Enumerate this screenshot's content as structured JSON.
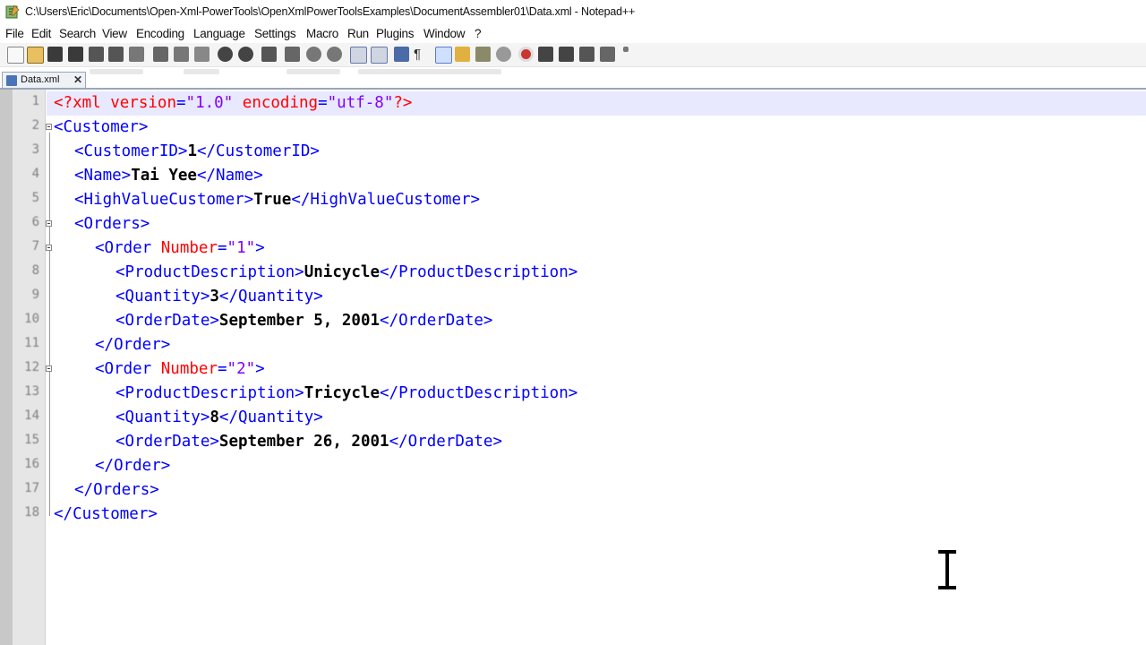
{
  "window": {
    "title": "C:\\Users\\Eric\\Documents\\Open-Xml-PowerTools\\OpenXmlPowerToolsExamples\\DocumentAssembler01\\Data.xml - Notepad++"
  },
  "menu": [
    "File",
    "Edit",
    "Search",
    "View",
    "Encoding",
    "Language",
    "Settings",
    "Macro",
    "Run",
    "Plugins",
    "Window",
    "?"
  ],
  "tab": {
    "label": "Data.xml",
    "close": "✕"
  },
  "line_numbers": [
    "1",
    "2",
    "3",
    "4",
    "5",
    "6",
    "7",
    "8",
    "9",
    "10",
    "11",
    "12",
    "13",
    "14",
    "15",
    "16",
    "17",
    "18"
  ],
  "code": {
    "l1": {
      "open": "<?xml",
      "attr1": "version",
      "eq1": "=",
      "val1": "\"1.0\"",
      "attr2": "encoding",
      "eq2": "=",
      "val2": "\"utf-8\"",
      "close": "?>"
    },
    "l2": {
      "tag": "<Customer>"
    },
    "l3": {
      "open": "<CustomerID>",
      "text": "1",
      "close": "</CustomerID>"
    },
    "l4": {
      "open": "<Name>",
      "text": "Tai Yee",
      "close": "</Name>"
    },
    "l5": {
      "open": "<HighValueCustomer>",
      "text": "True",
      "close": "</HighValueCustomer>"
    },
    "l6": {
      "tag": "<Orders>"
    },
    "l7": {
      "open": "<Order",
      "attr": "Number",
      "eq": "=",
      "val": "\"1\"",
      "close": ">"
    },
    "l8": {
      "open": "<ProductDescription>",
      "text": "Unicycle",
      "close": "</ProductDescription>"
    },
    "l9": {
      "open": "<Quantity>",
      "text": "3",
      "close": "</Quantity>"
    },
    "l10": {
      "open": "<OrderDate>",
      "text": "September 5, 2001",
      "close": "</OrderDate>"
    },
    "l11": {
      "tag": "</Order>"
    },
    "l12": {
      "open": "<Order",
      "attr": "Number",
      "eq": "=",
      "val": "\"2\"",
      "close": ">"
    },
    "l13": {
      "open": "<ProductDescription>",
      "text": "Tricycle",
      "close": "</ProductDescription>"
    },
    "l14": {
      "open": "<Quantity>",
      "text": "8",
      "close": "</Quantity>"
    },
    "l15": {
      "open": "<OrderDate>",
      "text": "September 26, 2001",
      "close": "</OrderDate>"
    },
    "l16": {
      "tag": "</Order>"
    },
    "l17": {
      "tag": "</Orders>"
    },
    "l18": {
      "tag": "</Customer>"
    }
  },
  "colors": {
    "tag": "#0000ff",
    "attribute": "#ff0000",
    "attribute_value": "#8000ff",
    "text": "#000000",
    "current_line": "#e8e8ff",
    "gutter": "#e6e6e6"
  },
  "toolbar_icons": [
    "new-file-icon",
    "open-file-icon",
    "save-icon",
    "save-all-icon",
    "close-icon",
    "close-all-icon",
    "print-icon",
    "cut-icon",
    "copy-icon",
    "paste-icon",
    "undo-icon",
    "redo-icon",
    "find-icon",
    "replace-icon",
    "zoom-in-icon",
    "zoom-out-icon",
    "sync-vertical-icon",
    "sync-horizontal-icon",
    "word-wrap-icon",
    "show-all-chars-icon",
    "indent-guide-icon",
    "user-lang-icon",
    "doc-map-icon",
    "function-list-icon",
    "folder-workspace-icon",
    "record-macro-icon",
    "stop-macro-icon",
    "play-macro-icon",
    "run-macro-multiple-icon",
    "save-macro-icon"
  ]
}
